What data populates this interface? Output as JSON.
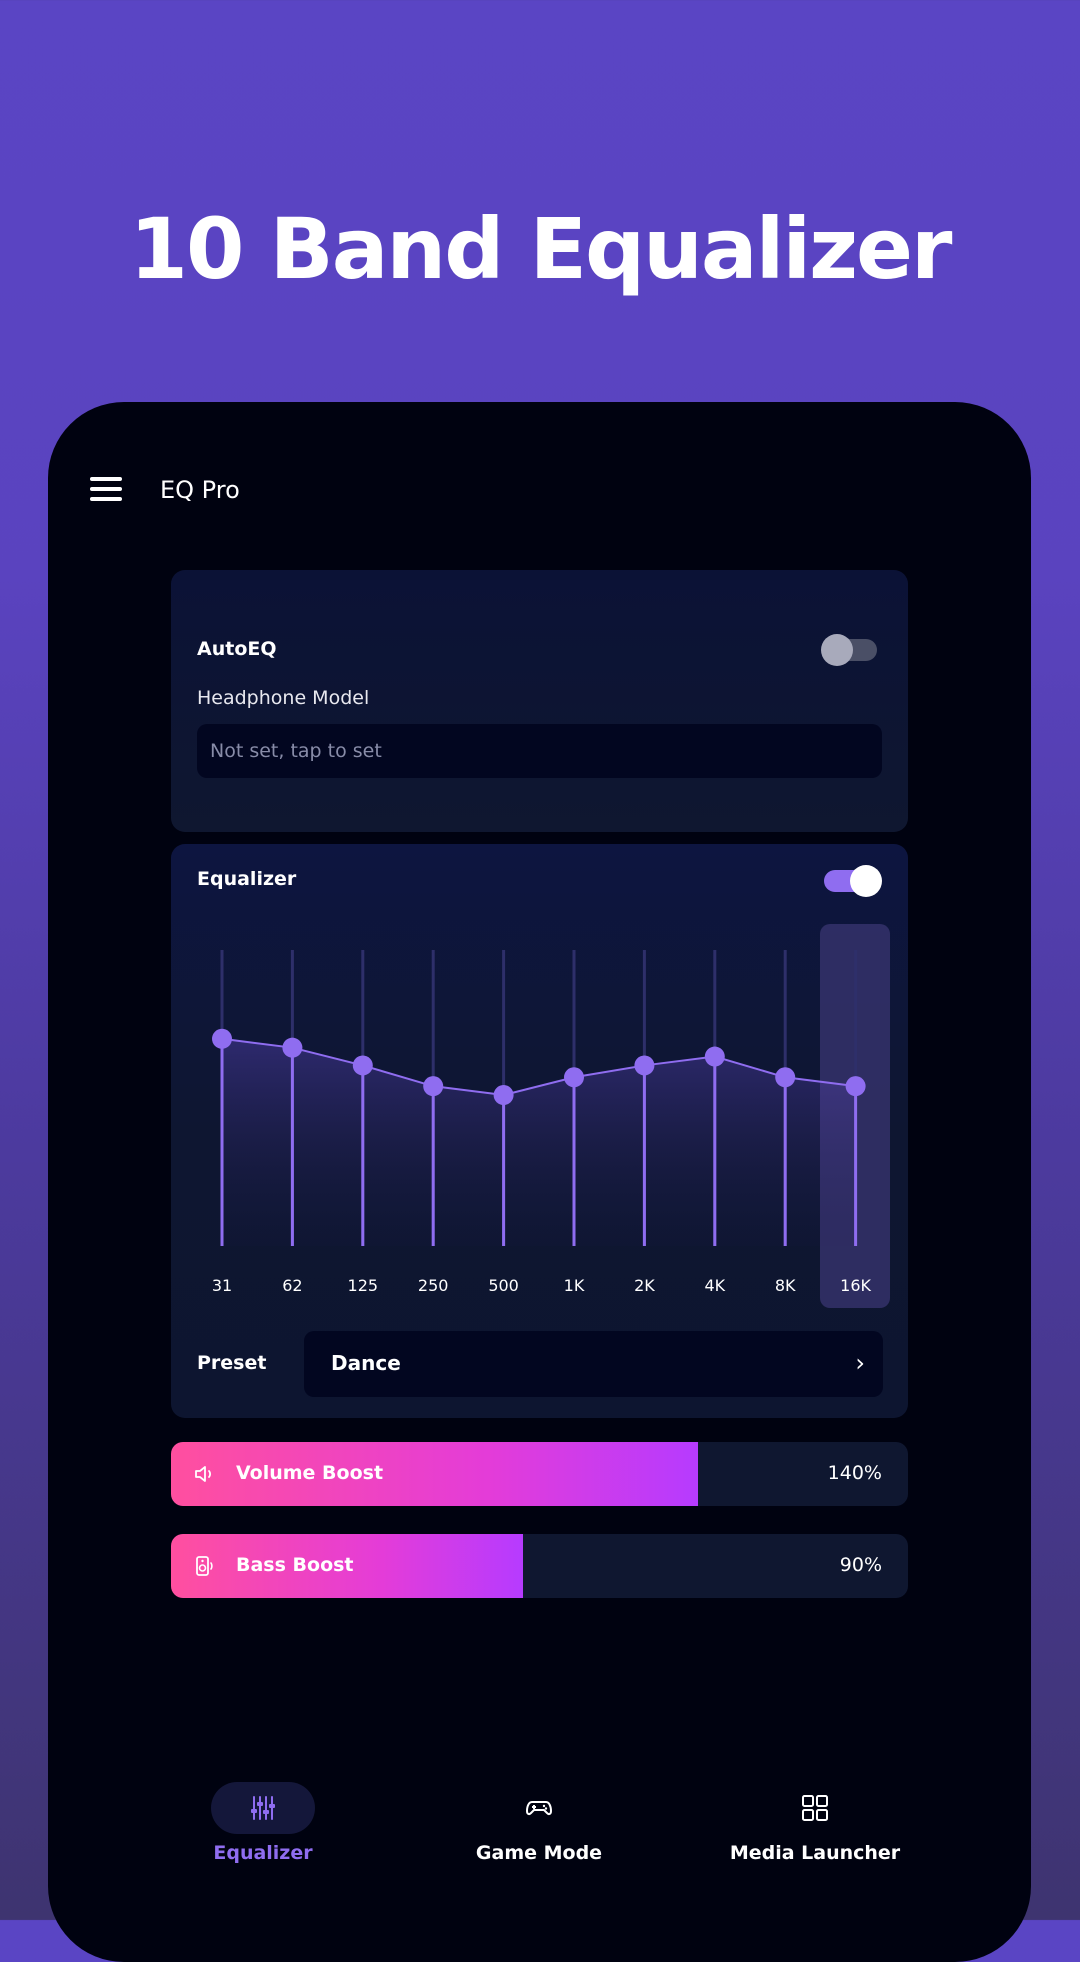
{
  "headline": "10 Band Equalizer",
  "app": {
    "title": "EQ Pro"
  },
  "autoeq": {
    "label": "AutoEQ",
    "enabled": false,
    "headphone_label": "Headphone Model",
    "headphone_value": "Not set, tap to set"
  },
  "equalizer": {
    "label": "Equalizer",
    "enabled": true,
    "bands": [
      "31",
      "62",
      "125",
      "250",
      "500",
      "1K",
      "2K",
      "4K",
      "8K",
      "16K"
    ],
    "levels": [
      0.7,
      0.67,
      0.61,
      0.54,
      0.51,
      0.57,
      0.61,
      0.64,
      0.57,
      0.54
    ],
    "selected_band": "16K",
    "preset_label": "Preset",
    "preset_value": "Dance"
  },
  "boosts": {
    "volume": {
      "label": "Volume Boost",
      "value": "140%",
      "fill": 0.715
    },
    "bass": {
      "label": "Bass Boost",
      "value": "90%",
      "fill": 0.478
    }
  },
  "nav": {
    "items": [
      {
        "label": "Equalizer",
        "icon": "sliders-icon",
        "active": true
      },
      {
        "label": "Game Mode",
        "icon": "gamepad-icon",
        "active": false
      },
      {
        "label": "Media Launcher",
        "icon": "grid-icon",
        "active": false
      }
    ]
  },
  "colors": {
    "accent": "#8f6df0",
    "boost_start": "#ff4f9f",
    "boost_end": "#b63bff",
    "background_top": "#5a45c4"
  }
}
